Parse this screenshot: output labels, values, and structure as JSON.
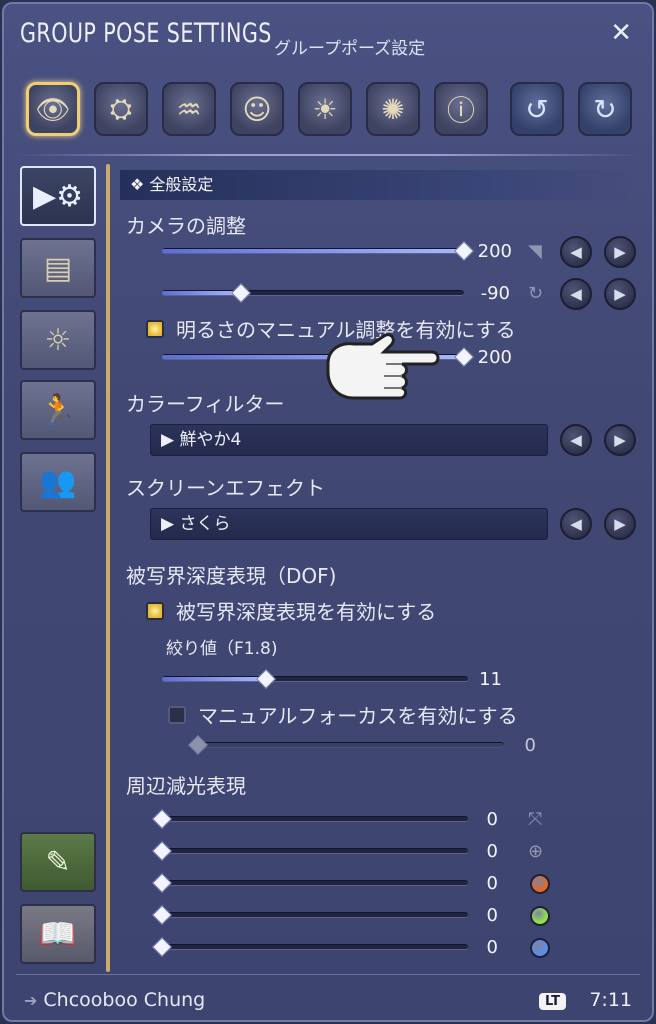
{
  "window": {
    "title": "GROUP POSE SETTINGS",
    "subtitle": "グループポーズ設定",
    "close_label": "✕"
  },
  "toolbar": {
    "buttons": [
      {
        "icon": "eye-icon",
        "glyph": "👁",
        "active": true
      },
      {
        "icon": "light-icon",
        "glyph": "⛭"
      },
      {
        "icon": "pose-icon",
        "glyph": "♒"
      },
      {
        "icon": "expression-icon",
        "glyph": "☺"
      },
      {
        "icon": "time-lock-icon",
        "glyph": "☀"
      },
      {
        "icon": "effect-icon",
        "glyph": "✺"
      },
      {
        "icon": "info-icon",
        "glyph": "ⓘ"
      },
      {
        "icon": "reset-icon",
        "glyph": "↺"
      },
      {
        "icon": "reset-all-icon",
        "glyph": "↻"
      }
    ]
  },
  "sidebar": {
    "items": [
      {
        "icon": "camera-settings-icon",
        "glyph": "▶⚙",
        "active": true
      },
      {
        "icon": "frame-icon",
        "glyph": "▤"
      },
      {
        "icon": "lighting-icon",
        "glyph": "☼"
      },
      {
        "icon": "character-pose-icon",
        "glyph": "🏃"
      },
      {
        "icon": "group-icon",
        "glyph": "👥"
      }
    ],
    "bottom": [
      {
        "icon": "guide-book-icon",
        "glyph": "✎"
      },
      {
        "icon": "manual-book-icon",
        "glyph": "📖"
      }
    ]
  },
  "section": {
    "header": "❖ 全般設定"
  },
  "camera": {
    "label": "カメラの調整",
    "slider1": {
      "value": "200",
      "percent": 100
    },
    "slider2": {
      "value": "-90",
      "percent": 26
    },
    "brightness_label": "明るさのマニュアル調整を有効にする",
    "brightness_checked": true,
    "slider3": {
      "value": "200",
      "percent": 100
    }
  },
  "color_filter": {
    "label": "カラーフィルター",
    "value": "▶ 鮮やか4"
  },
  "screen_effect": {
    "label": "スクリーンエフェクト",
    "value": "▶ さくら"
  },
  "dof": {
    "label": "被写界深度表現（DOF)",
    "enable_label": "被写界深度表現を有効にする",
    "enable_checked": true,
    "aperture_label": "絞り値（F1.8)",
    "aperture": {
      "value": "11",
      "percent": 34
    },
    "manual_focus_label": "マニュアルフォーカスを有効にする",
    "manual_focus_checked": false,
    "focus": {
      "value": "0",
      "percent": 0
    }
  },
  "vignette": {
    "label": "周辺減光表現",
    "rows": [
      {
        "value": "0",
        "icon": "expand-icon",
        "color": ""
      },
      {
        "value": "0",
        "icon": "anchor-icon",
        "color": ""
      },
      {
        "value": "0",
        "icon": "",
        "color": "#e0692a"
      },
      {
        "value": "0",
        "icon": "",
        "color": "#8fe04c"
      },
      {
        "value": "0",
        "icon": "",
        "color": "#5b8ee8"
      }
    ]
  },
  "footer": {
    "arrow": "➔",
    "user": "Chcooboo Chung",
    "badge": "LT",
    "time": "7:11"
  }
}
